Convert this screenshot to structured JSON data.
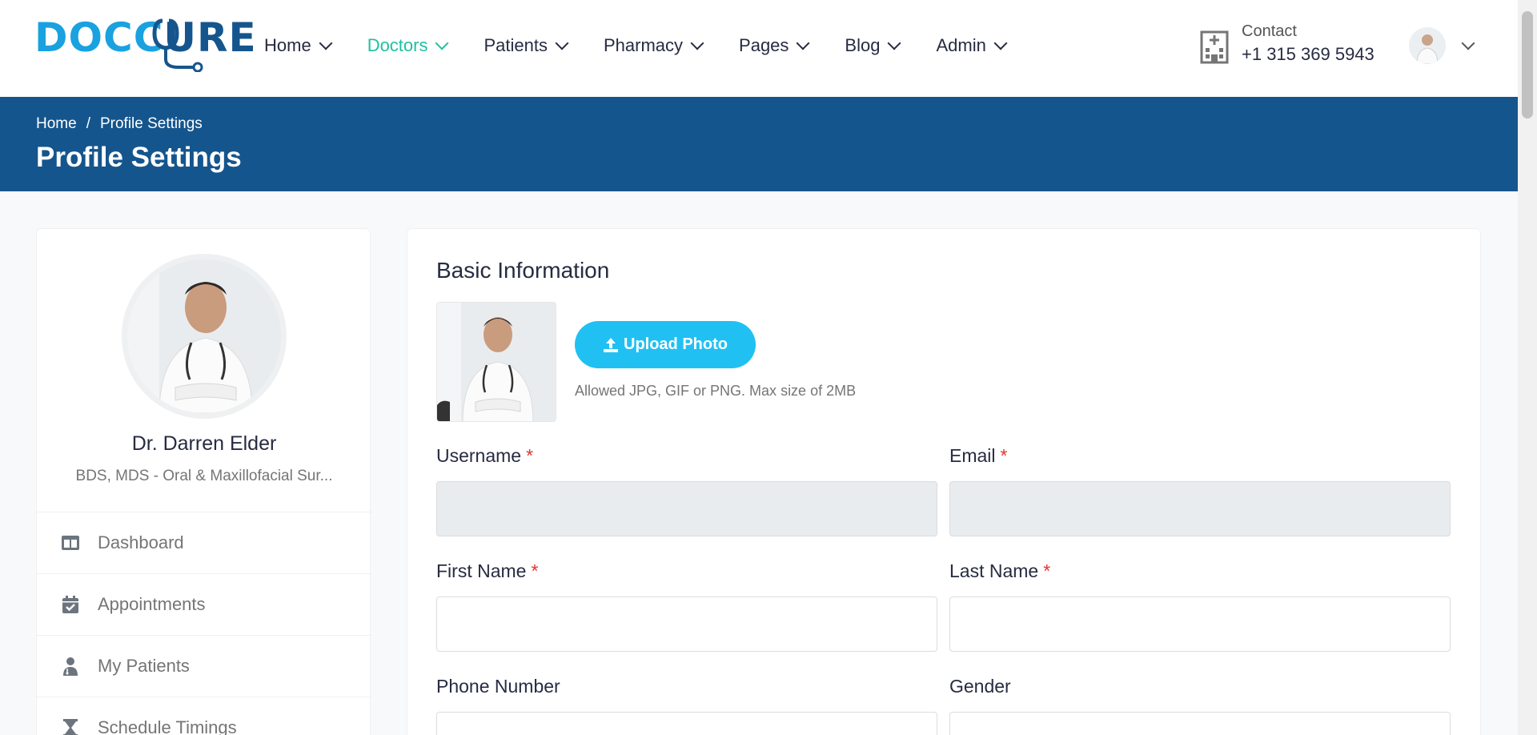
{
  "header": {
    "logo_part1": "DOCC",
    "logo_part2": "URE",
    "nav": [
      {
        "label": "Home"
      },
      {
        "label": "Doctors"
      },
      {
        "label": "Patients"
      },
      {
        "label": "Pharmacy"
      },
      {
        "label": "Pages"
      },
      {
        "label": "Blog"
      },
      {
        "label": "Admin"
      }
    ],
    "active_nav": "Doctors",
    "contact_label": "Contact",
    "contact_phone": "+1 315 369 5943"
  },
  "banner": {
    "breadcrumb_home": "Home",
    "breadcrumb_sep": "/",
    "breadcrumb_current": "Profile Settings",
    "title": "Profile Settings"
  },
  "sidebar": {
    "name": "Dr. Darren Elder",
    "specialty": "BDS, MDS - Oral & Maxillofacial Sur...",
    "menu": [
      {
        "label": "Dashboard",
        "icon": "dashboard-icon"
      },
      {
        "label": "Appointments",
        "icon": "calendar-check-icon"
      },
      {
        "label": "My Patients",
        "icon": "patient-icon"
      },
      {
        "label": "Schedule Timings",
        "icon": "hourglass-icon"
      }
    ]
  },
  "main": {
    "title": "Basic Information",
    "upload_label": "Upload Photo",
    "upload_hint": "Allowed JPG, GIF or PNG. Max size of 2MB",
    "fields": {
      "username_label": "Username",
      "email_label": "Email",
      "first_name_label": "First Name",
      "last_name_label": "Last Name",
      "phone_label": "Phone Number",
      "gender_label": "Gender",
      "required_mark": "*"
    }
  },
  "colors": {
    "brand_blue": "#15558d",
    "accent_cyan": "#20c0f3",
    "active_nav": "#20c0a0",
    "required": "#e3342f"
  }
}
